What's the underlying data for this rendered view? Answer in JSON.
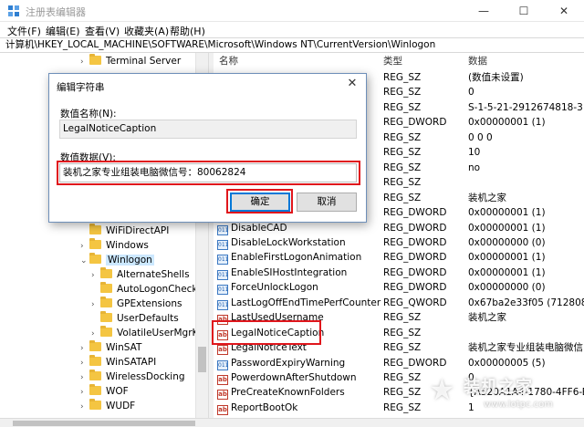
{
  "window": {
    "title": "注册表编辑器",
    "minimize": "—",
    "maximize": "☐",
    "close": "✕"
  },
  "menu": [
    "文件(F)",
    "编辑(E)",
    "查看(V)",
    "收藏夹(A)",
    "帮助(H)"
  ],
  "address": "计算机\\HKEY_LOCAL_MACHINE\\SOFTWARE\\Microsoft\\Windows NT\\CurrentVersion\\Winlogon",
  "tree": [
    {
      "label": "Terminal Server",
      "chev": "›"
    },
    {
      "label": "WiFiDirectAPI",
      "chev": ""
    },
    {
      "label": "Windows",
      "chev": "›"
    },
    {
      "label": "Winlogon",
      "chev": "⌄"
    },
    {
      "label": "AlternateShells",
      "chev": "›"
    },
    {
      "label": "AutoLogonChecked",
      "chev": ""
    },
    {
      "label": "GPExtensions",
      "chev": "›"
    },
    {
      "label": "UserDefaults",
      "chev": ""
    },
    {
      "label": "VolatileUserMgrKey",
      "chev": "›"
    },
    {
      "label": "WinSAT",
      "chev": "›"
    },
    {
      "label": "WinSATAPI",
      "chev": "›"
    },
    {
      "label": "WirelessDocking",
      "chev": "›"
    },
    {
      "label": "WOF",
      "chev": "›"
    },
    {
      "label": "WUDF",
      "chev": "›"
    }
  ],
  "columns": {
    "name": "名称",
    "type": "类型",
    "data": "数据"
  },
  "values": [
    {
      "name": "",
      "type": "REG_SZ",
      "data": "(数值未设置)",
      "icon": "ab"
    },
    {
      "name": "",
      "type": "REG_SZ",
      "data": "0",
      "icon": "ab"
    },
    {
      "name": "",
      "type": "REG_SZ",
      "data": "S-1-5-21-2912674818-3",
      "icon": "ab"
    },
    {
      "name": "",
      "type": "REG_DWORD",
      "data": "0x00000001 (1)",
      "icon": "bin"
    },
    {
      "name": "",
      "type": "REG_SZ",
      "data": "0 0 0",
      "icon": "ab"
    },
    {
      "name": "",
      "type": "REG_SZ",
      "data": "10",
      "icon": "ab"
    },
    {
      "name": "",
      "type": "REG_SZ",
      "data": "no",
      "icon": "ab"
    },
    {
      "name": "",
      "type": "REG_SZ",
      "data": "",
      "icon": "ab"
    },
    {
      "name": "",
      "type": "REG_SZ",
      "data": "装机之家",
      "icon": "ab"
    },
    {
      "name": "",
      "type": "REG_DWORD",
      "data": "0x00000001 (1)",
      "icon": "bin"
    },
    {
      "name": "DisableCAD",
      "type": "REG_DWORD",
      "data": "0x00000001 (1)",
      "icon": "bin"
    },
    {
      "name": "DisableLockWorkstation",
      "type": "REG_DWORD",
      "data": "0x00000000 (0)",
      "icon": "bin"
    },
    {
      "name": "EnableFirstLogonAnimation",
      "type": "REG_DWORD",
      "data": "0x00000001 (1)",
      "icon": "bin"
    },
    {
      "name": "EnableSIHostIntegration",
      "type": "REG_DWORD",
      "data": "0x00000001 (1)",
      "icon": "bin"
    },
    {
      "name": "ForceUnlockLogon",
      "type": "REG_DWORD",
      "data": "0x00000000 (0)",
      "icon": "bin"
    },
    {
      "name": "LastLogOffEndTimePerfCounter",
      "type": "REG_QWORD",
      "data": "0x67ba2e33f05 (712808",
      "icon": "bin"
    },
    {
      "name": "LastUsedUsername",
      "type": "REG_SZ",
      "data": "装机之家",
      "icon": "ab"
    },
    {
      "name": "LegalNoticeCaption",
      "type": "REG_SZ",
      "data": "",
      "icon": "ab"
    },
    {
      "name": "LegalNoticeText",
      "type": "REG_SZ",
      "data": "装机之家专业组装电脑微信",
      "icon": "ab"
    },
    {
      "name": "PasswordExpiryWarning",
      "type": "REG_DWORD",
      "data": "0x00000005 (5)",
      "icon": "bin"
    },
    {
      "name": "PowerdownAfterShutdown",
      "type": "REG_SZ",
      "data": "0",
      "icon": "ab"
    },
    {
      "name": "PreCreateKnownFolders",
      "type": "REG_SZ",
      "data": "{A520A1A4-1780-4FF6-B",
      "icon": "ab"
    },
    {
      "name": "ReportBootOk",
      "type": "REG_SZ",
      "data": "1",
      "icon": "ab"
    }
  ],
  "dialog": {
    "title": "编辑字符串",
    "close": "✕",
    "name_label": "数值名称(N):",
    "name_value": "LegalNoticeCaption",
    "data_label": "数值数据(V):",
    "data_value": "装机之家专业组装电脑微信号：80062824",
    "ok": "确定",
    "cancel": "取消"
  },
  "watermark": {
    "name": "装机之家",
    "url": "www.lotpc.com"
  }
}
